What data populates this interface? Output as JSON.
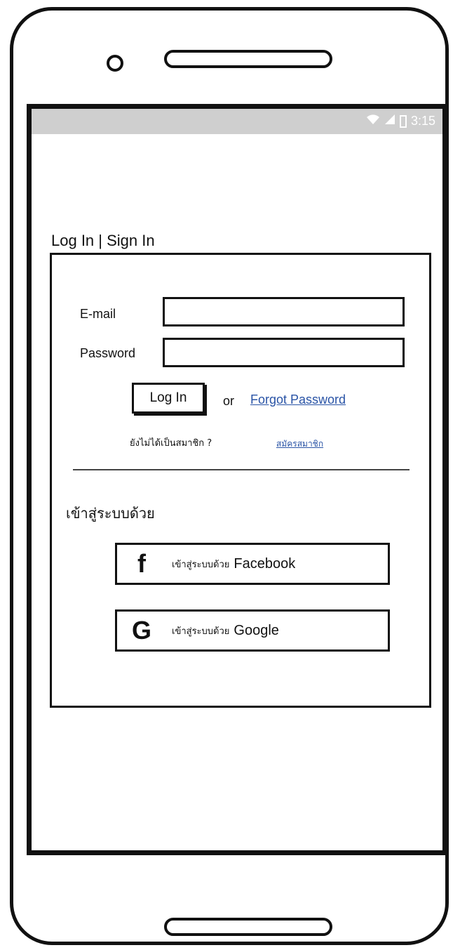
{
  "status_bar": {
    "time": "3:15",
    "icons": [
      "wifi-icon",
      "signal-icon",
      "battery-icon"
    ]
  },
  "page": {
    "title": "Log In | Sign In"
  },
  "form": {
    "email_label": "E-mail",
    "email_value": "",
    "password_label": "Password",
    "password_value": "",
    "login_label": "Log In",
    "or_label": "or",
    "forgot_link": "Forgot Password",
    "not_member_text": "ยังไม่ได้เป็นสมาชิก ?",
    "signup_link": "สมัครสมาชิก"
  },
  "social": {
    "section_label": "เข้าสู่ระบบด้วย",
    "facebook": {
      "icon": "f",
      "prefix": "เข้าสู่ระบบด้วย",
      "brand": "Facebook"
    },
    "google": {
      "icon": "G",
      "prefix": "เข้าสู่ระบบด้วย",
      "brand": "Google"
    }
  },
  "colors": {
    "link": "#2a54a6",
    "status_bar": "#cfcfcf"
  }
}
